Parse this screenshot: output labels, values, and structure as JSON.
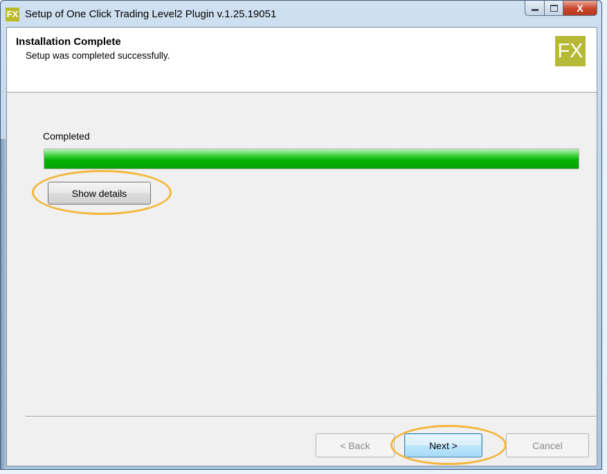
{
  "window": {
    "title": "Setup of One Click Trading Level2 Plugin v.1.25.19051",
    "app_icon": "FX",
    "close_glyph": "X"
  },
  "header": {
    "title": "Installation Complete",
    "subtitle": "Setup was completed successfully.",
    "logo_text": "FX"
  },
  "body": {
    "status_label": "Completed",
    "progress_fraction": 1.0,
    "details_button": "Show details"
  },
  "footer": {
    "back_label": "< Back",
    "next_label": "Next >",
    "cancel_label": "Cancel"
  },
  "colors": {
    "progress_green": "#06b306",
    "highlight_ring": "#f4b63a",
    "logo": "#b5b936"
  }
}
